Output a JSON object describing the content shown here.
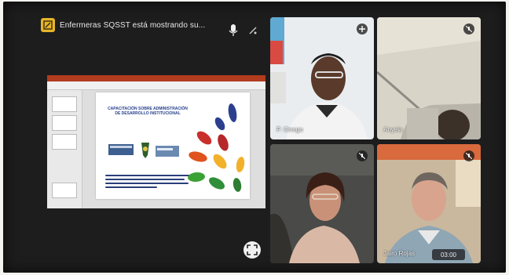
{
  "header": {
    "share_text": "Enfermeras SQSST está mostrando su...",
    "share_icon": "screen-share-icon",
    "mic_icon": "microphone-icon",
    "more_icon": "more-icon"
  },
  "slide": {
    "title": "CAPACITACIÓN SOBRE ADMINISTRACIÓN DE DESARROLLO INSTITUCIONAL"
  },
  "participants": [
    {
      "name": "P. Orrego",
      "icon": "pin-icon"
    },
    {
      "name": "Anyela",
      "icon": "mic-off-icon"
    },
    {
      "name": "",
      "icon": "mic-off-icon"
    },
    {
      "name": "Jairo Rojas",
      "icon": "mic-off-icon",
      "timer": "03:00"
    }
  ],
  "controls": {
    "expand_icon": "fullscreen-icon"
  },
  "colors": {
    "share_badge": "#e6b52a",
    "background": "#1d1d1e",
    "title_bar": "#b13c1e"
  }
}
